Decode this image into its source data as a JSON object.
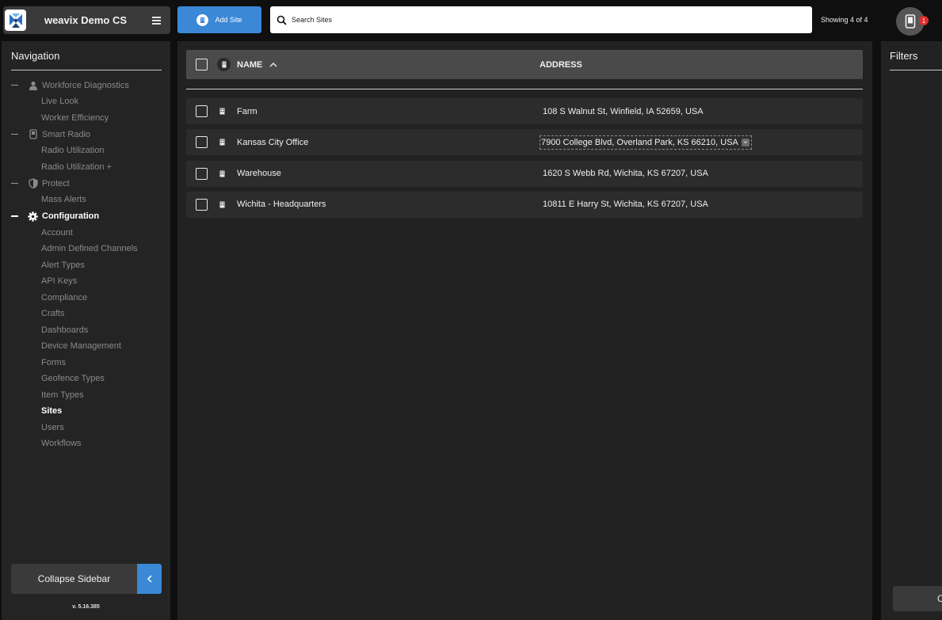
{
  "header": {
    "brand_name": "weavix Demo CS",
    "add_site_label": "Add Site",
    "search_placeholder": "Search Sites",
    "showing_text": "Showing 4 of 4",
    "notification_count": "1"
  },
  "sidebar": {
    "title": "Navigation",
    "groups": [
      {
        "label": "Workforce Diagnostics",
        "icon": "person-icon",
        "items": [
          "Live Look",
          "Worker Efficiency"
        ]
      },
      {
        "label": "Smart Radio",
        "icon": "radio-icon",
        "items": [
          "Radio Utilization",
          "Radio Utilization +"
        ]
      },
      {
        "label": "Protect",
        "icon": "shield-icon",
        "items": [
          "Mass Alerts"
        ]
      },
      {
        "label": "Configuration",
        "icon": "gear-icon",
        "active": true,
        "items": [
          "Account",
          "Admin Defined Channels",
          "Alert Types",
          "API Keys",
          "Compliance",
          "Crafts",
          "Dashboards",
          "Device Management",
          "Forms",
          "Geofence Types",
          "Item Types",
          "Sites",
          "Users",
          "Workflows"
        ],
        "active_item": "Sites"
      }
    ],
    "collapse_label": "Collapse Sidebar",
    "version": "v. 5.16.385"
  },
  "table": {
    "name_header": "NAME",
    "address_header": "ADDRESS",
    "rows": [
      {
        "name": "Farm",
        "address": "108 S Walnut St, Winfield, IA 52659, USA"
      },
      {
        "name": "Kansas City Office",
        "address": "7900 College Blvd, Overland Park, KS 66210, USA"
      },
      {
        "name": "Warehouse",
        "address": "1620 S Webb Rd, Wichita, KS 67207, USA"
      },
      {
        "name": "Wichita - Headquarters",
        "address": "10811 E Harry St, Wichita, KS 67207, USA"
      }
    ]
  },
  "filters": {
    "title": "Filters",
    "button_label": "C"
  },
  "colors": {
    "accent": "#3a88d6",
    "badge": "#e02c2c"
  }
}
